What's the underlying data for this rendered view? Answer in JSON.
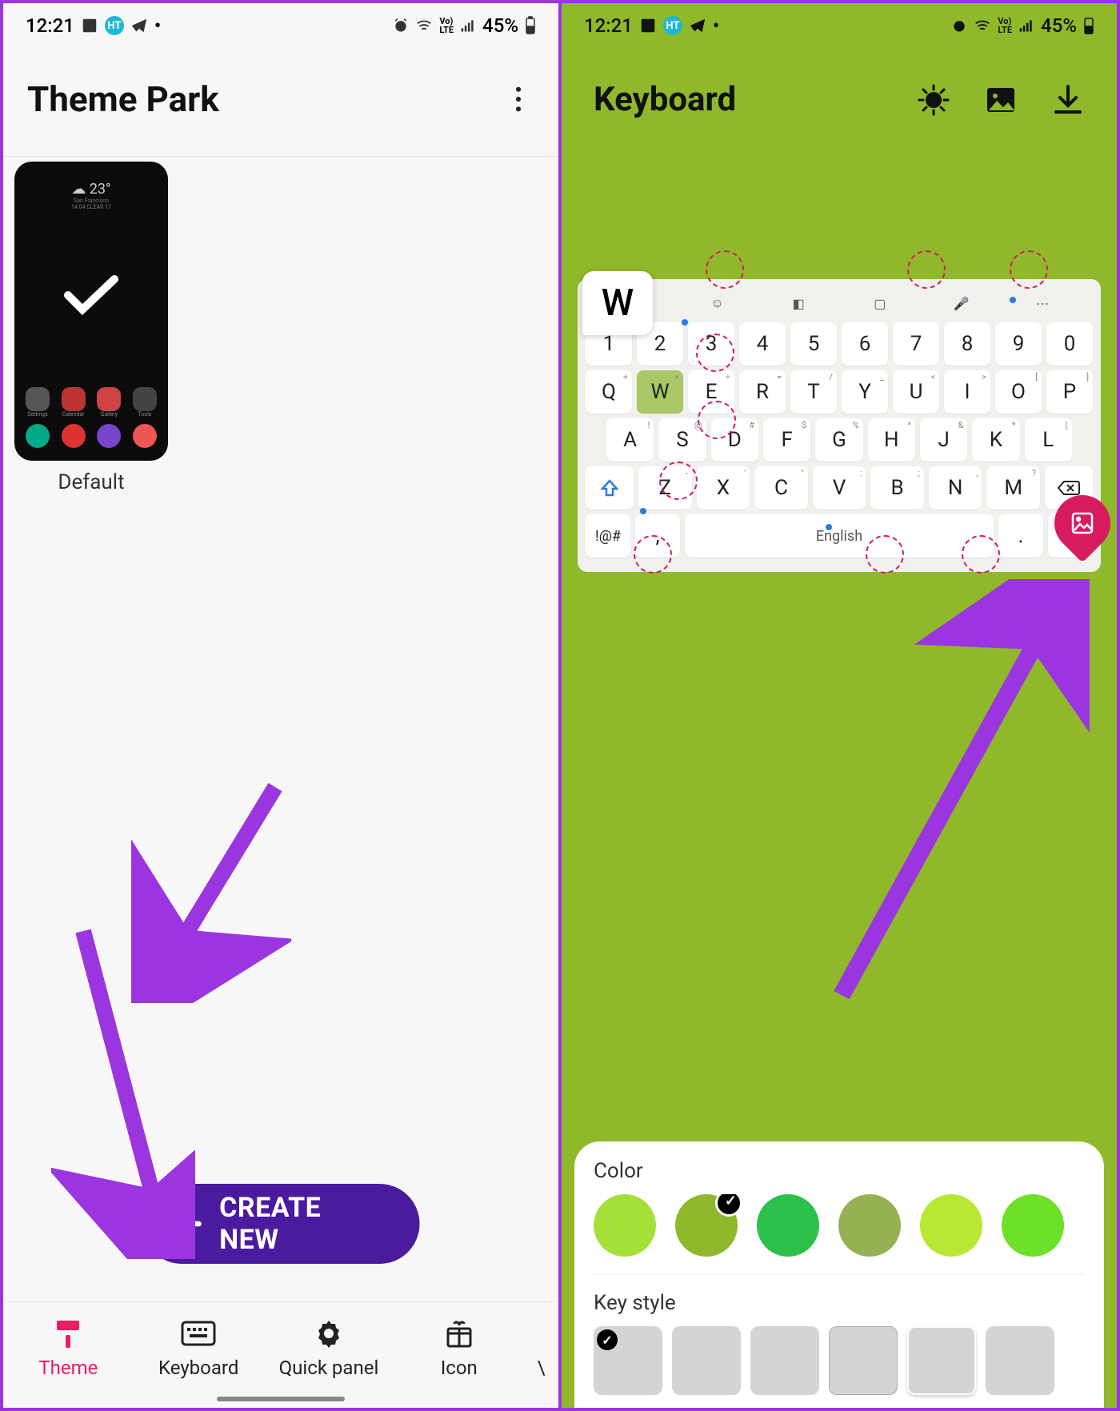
{
  "status": {
    "time": "12:21",
    "battery": "45%"
  },
  "left": {
    "title": "Theme Park",
    "thumb_label": "Default",
    "create_label": "CREATE NEW",
    "nav": {
      "theme": "Theme",
      "keyboard": "Keyboard",
      "quick": "Quick panel",
      "icon": "Icon"
    }
  },
  "right": {
    "title": "Keyboard",
    "popup": "W",
    "space_label": "English",
    "sym_label": "!@#",
    "sheet": {
      "color": "Color",
      "keystyle": "Key style"
    },
    "colors": [
      "#a4e038",
      "#8fb82b",
      "#2bc04a",
      "#96b154",
      "#b8e834",
      "#6de028"
    ],
    "selected_color": 1,
    "num_row": [
      "1",
      "2",
      "3",
      "4",
      "5",
      "6",
      "7",
      "8",
      "9",
      "0"
    ],
    "row_q": [
      "Q",
      "W",
      "E",
      "R",
      "T",
      "Y",
      "U",
      "I",
      "O",
      "P"
    ],
    "row_a": [
      "A",
      "S",
      "D",
      "F",
      "G",
      "H",
      "J",
      "K",
      "L"
    ],
    "row_z": [
      "Z",
      "X",
      "C",
      "V",
      "B",
      "N",
      "M"
    ]
  }
}
